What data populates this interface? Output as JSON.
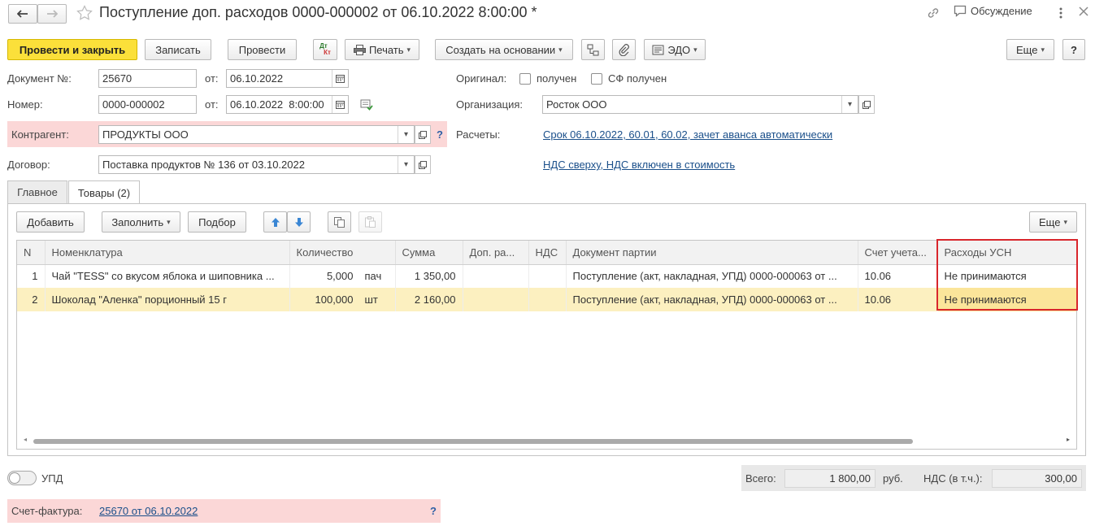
{
  "header": {
    "title": "Поступление доп. расходов 0000-000002 от 06.10.2022 8:00:00 *",
    "discussion_label": "Обсуждение"
  },
  "toolbar": {
    "post_close": "Провести и закрыть",
    "save": "Записать",
    "post": "Провести",
    "dtkt_top": "Дт",
    "dtkt_bottom": "Кт",
    "print": "Печать",
    "create_based": "Создать на основании",
    "edo": "ЭДО",
    "more": "Еще",
    "help": "?"
  },
  "form": {
    "doc_no_label": "Документ №:",
    "doc_no": "25670",
    "from_label": "от:",
    "doc_date": "06.10.2022",
    "number_label": "Номер:",
    "number": "0000-000002",
    "number_date": "06.10.2022  8:00:00",
    "counterparty_label": "Контрагент:",
    "counterparty": "ПРОДУКТЫ ООО",
    "contract_label": "Договор:",
    "contract": "Поставка продуктов № 136 от 03.10.2022",
    "original_label": "Оригинал:",
    "received_label": "получен",
    "sf_received_label": "СФ получен",
    "org_label": "Организация:",
    "org": "Росток ООО",
    "settlements_label": "Расчеты:",
    "settlements_link": "Срок 06.10.2022, 60.01, 60.02, зачет аванса автоматически",
    "vat_link": "НДС сверху, НДС включен в стоимость",
    "help_q": "?"
  },
  "tabs": [
    {
      "label": "Главное"
    },
    {
      "label": "Товары (2)"
    }
  ],
  "table_toolbar": {
    "add": "Добавить",
    "fill": "Заполнить",
    "pick": "Подбор",
    "more": "Еще"
  },
  "table": {
    "columns": [
      "N",
      "Номенклатура",
      "Количество",
      "Сумма",
      "Доп. ра...",
      "НДС",
      "Документ партии",
      "Счет учета...",
      "Расходы УСН"
    ],
    "rows": [
      {
        "n": "1",
        "name": "Чай \"TESS\" со вкусом яблока и шиповника ...",
        "qty": "5,000",
        "unit": "пач",
        "sum": "1 350,00",
        "extra": "",
        "vat": "",
        "doc": "Поступление (акт, накладная, УПД) 0000-000063 от ...",
        "account": "10.06",
        "usn": "Не принимаются"
      },
      {
        "n": "2",
        "name": "Шоколад \"Аленка\" порционный 15 г",
        "qty": "100,000",
        "unit": "шт",
        "sum": "2 160,00",
        "extra": "",
        "vat": "",
        "doc": "Поступление (акт, накладная, УПД) 0000-000063 от ...",
        "account": "10.06",
        "usn": "Не принимаются"
      }
    ]
  },
  "footer": {
    "upd_label": "УПД",
    "total_label": "Всего:",
    "total": "1 800,00",
    "currency": "руб.",
    "vat_label": "НДС (в т.ч.):",
    "vat": "300,00",
    "invoice_label": "Счет-фактура:",
    "invoice_link": "25670 от 06.10.2022",
    "help_q": "?"
  },
  "colors": {
    "primary": "#fbe03a",
    "highlight_border": "#d9262c",
    "link": "#1a4f8a",
    "pink": "#fbd7d7"
  }
}
